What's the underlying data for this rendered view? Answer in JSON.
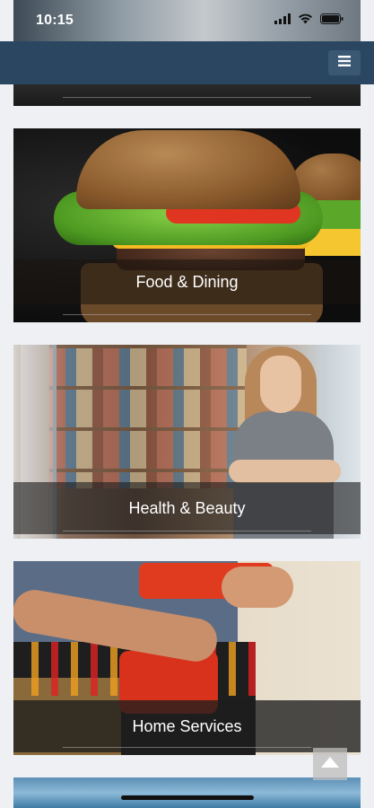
{
  "status_bar": {
    "time": "10:15",
    "icons": [
      "signal-icon",
      "wifi-icon",
      "battery-icon"
    ]
  },
  "header": {
    "menu_icon": "hamburger-menu-icon",
    "color": "#2b4660"
  },
  "categories": [
    {
      "label": "Food & Dining"
    },
    {
      "label": "Health & Beauty"
    },
    {
      "label": "Home Services"
    }
  ],
  "scroll_top": {
    "icon": "arrow-up-icon"
  },
  "colors": {
    "accent": "#2b4660",
    "background": "#eef0f4"
  }
}
